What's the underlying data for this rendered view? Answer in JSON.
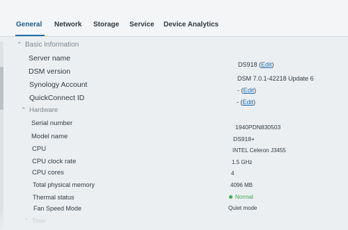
{
  "tabs": [
    {
      "label": "General",
      "active": true
    },
    {
      "label": "Network"
    },
    {
      "label": "Storage"
    },
    {
      "label": "Service"
    },
    {
      "label": "Device Analytics"
    }
  ],
  "sections": {
    "basic": {
      "title": "Basic Information"
    },
    "hardware": {
      "title": "Hardware"
    },
    "time": {
      "title": "Time"
    }
  },
  "basic_info": {
    "server_name": {
      "label": "Server name",
      "value": "DS918",
      "link": "Edit"
    },
    "dsm_version": {
      "label": "DSM version",
      "value": "DSM 7.0.1-42218 Update 6"
    },
    "synology_account": {
      "label": "Synology Account",
      "value": "-",
      "link": "Edit"
    },
    "quickconnect_id": {
      "label": "QuickConnect ID",
      "value": "-",
      "link": "Edit"
    }
  },
  "hardware": {
    "serial_number": {
      "label": "Serial number",
      "value": "1940PDN830503"
    },
    "model_name": {
      "label": "Model name",
      "value": "DS918+"
    },
    "cpu": {
      "label": "CPU",
      "value": "INTEL Celeron J3455"
    },
    "cpu_clock_rate": {
      "label": "CPU clock rate",
      "value": "1.5 GHz"
    },
    "cpu_cores": {
      "label": "CPU cores",
      "value": "4"
    },
    "total_memory": {
      "label": "Total physical memory",
      "value": "4096 MB"
    },
    "thermal_status": {
      "label": "Thermal status",
      "value": "Normal"
    },
    "fan_speed_mode": {
      "label": "Fan Speed Mode",
      "value": "Quiet mode"
    }
  },
  "colors": {
    "link": "#1d6fb1",
    "status_normal": "#3bab52",
    "tab_active_underline": "#1e6fa6"
  },
  "icons": {
    "section_toggle": "chevron-up-icon",
    "status_dot": "status-dot-icon"
  }
}
